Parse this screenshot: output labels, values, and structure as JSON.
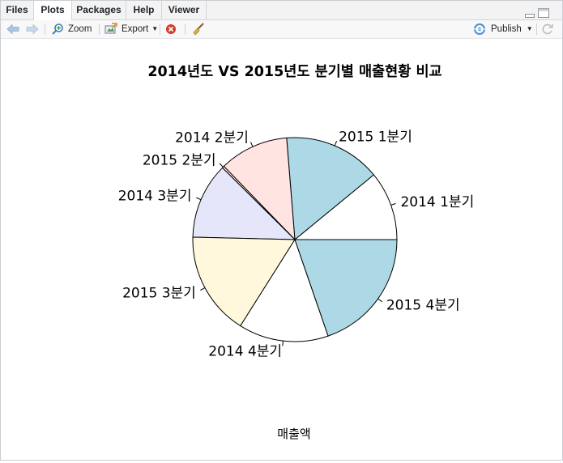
{
  "tabs": [
    {
      "label": "Files",
      "active": false
    },
    {
      "label": "Plots",
      "active": true
    },
    {
      "label": "Packages",
      "active": false
    },
    {
      "label": "Help",
      "active": false
    },
    {
      "label": "Viewer",
      "active": false
    }
  ],
  "toolbar": {
    "back_icon": "arrow-left-icon",
    "forward_icon": "arrow-right-icon",
    "zoom_label": "Zoom",
    "export_label": "Export",
    "remove_icon": "remove-plot-icon",
    "clear_icon": "broom-icon",
    "publish_label": "Publish",
    "refresh_icon": "refresh-icon"
  },
  "colors": {
    "lightblue": "#add8e6",
    "white": "#ffffff",
    "mistyrose": "#ffe4e1",
    "lavender": "#e6e6fa",
    "cornsilk": "#fff8dc"
  },
  "chart_data": {
    "type": "pie",
    "title": "2014년도 VS 2015년도 분기별 매출현황 비교",
    "xlabel": "매출액",
    "slices": [
      {
        "label": "2014 1분기",
        "value": 10,
        "color": "#ffffff"
      },
      {
        "label": "2015 1분기",
        "value": 14,
        "color": "#add8e6"
      },
      {
        "label": "2014 2분기",
        "value": 10,
        "color": "#ffe4e1"
      },
      {
        "label": "2015 2분기",
        "value": 0.3,
        "color": "#ffe4e1"
      },
      {
        "label": "2014 3분기",
        "value": 11,
        "color": "#e6e6fa"
      },
      {
        "label": "2015 3분기",
        "value": 15,
        "color": "#fff8dc"
      },
      {
        "label": "2014 4분기",
        "value": 13,
        "color": "#ffffff"
      },
      {
        "label": "2015 4분기",
        "value": 18,
        "color": "#add8e6"
      }
    ]
  }
}
